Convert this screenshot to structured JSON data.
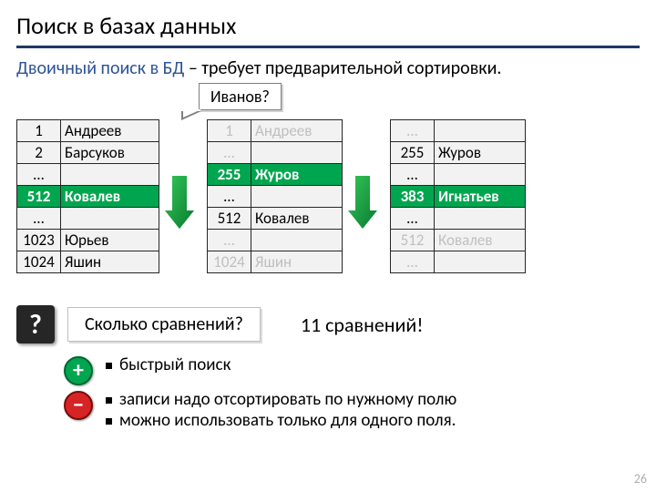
{
  "title": "Поиск в базах данных",
  "subtitle_blue": "Двоичный поиск в БД",
  "subtitle_rest": " – требует предварительной сортировки.",
  "callout": "Иванов?",
  "table1": [
    {
      "idx": "1",
      "name": "Андреев"
    },
    {
      "idx": "2",
      "name": "Барсуков"
    },
    {
      "idx": "…",
      "name": ""
    },
    {
      "idx": "512",
      "name": "Ковалев",
      "hl": true
    },
    {
      "idx": "…",
      "name": ""
    },
    {
      "idx": "1023",
      "name": "Юрьев"
    },
    {
      "idx": "1024",
      "name": "Яшин"
    }
  ],
  "table2": [
    {
      "idx": "1",
      "name": "Андреев",
      "dim": true,
      "dimtxt": true
    },
    {
      "idx": "…",
      "name": "",
      "dim": true
    },
    {
      "idx": "255",
      "name": "Журов",
      "hl": true
    },
    {
      "idx": "…",
      "name": ""
    },
    {
      "idx": "512",
      "name": "Ковалев"
    },
    {
      "idx": "…",
      "name": "",
      "dim": true
    },
    {
      "idx": "1024",
      "name": "Яшин",
      "dim": true,
      "dimtxt": true
    }
  ],
  "table3": [
    {
      "idx": "…",
      "name": "",
      "dim": true
    },
    {
      "idx": "255",
      "name": "Журов"
    },
    {
      "idx": "…",
      "name": ""
    },
    {
      "idx": "383",
      "name": "Игнатьев",
      "hl": true
    },
    {
      "idx": "…",
      "name": ""
    },
    {
      "idx": "512",
      "name": "Ковалев",
      "dim": true,
      "dimtxt": true
    },
    {
      "idx": "…",
      "name": "",
      "dim": true
    }
  ],
  "question": "Сколько сравнений?",
  "answer": "11 сравнений!",
  "bullet_plus": "быстрый поиск",
  "bullet_minus1": "записи надо отсортировать по нужному полю",
  "bullet_minus2": "можно использовать только для одного поля.",
  "pagenum": "26"
}
